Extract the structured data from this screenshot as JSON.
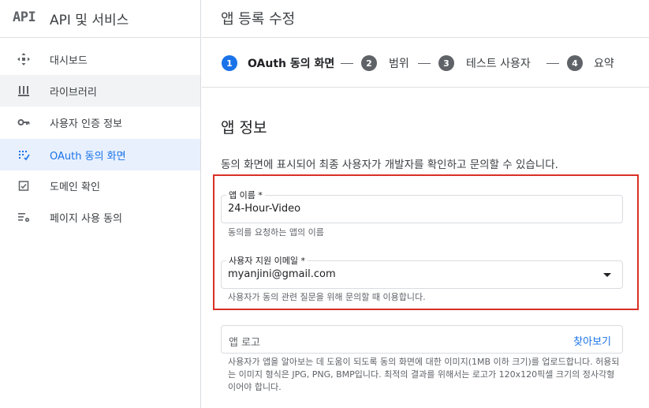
{
  "brand": {
    "logo": "API",
    "title": "API 및 서비스"
  },
  "sidebar": {
    "items": [
      {
        "label": "대시보드",
        "icon": "dashboard-icon"
      },
      {
        "label": "라이브러리",
        "icon": "library-icon"
      },
      {
        "label": "사용자 인증 정보",
        "icon": "key-icon"
      },
      {
        "label": "OAuth 동의 화면",
        "icon": "oauth-consent-icon"
      },
      {
        "label": "도메인 확인",
        "icon": "domain-verification-icon"
      },
      {
        "label": "페이지 사용 동의",
        "icon": "page-usage-icon"
      }
    ]
  },
  "header": {
    "title": "앱 등록 수정"
  },
  "stepper": {
    "steps": [
      {
        "number": "1",
        "label": "OAuth 동의 화면",
        "active": true
      },
      {
        "number": "2",
        "label": "범위",
        "active": false
      },
      {
        "number": "3",
        "label": "테스트 사용자",
        "active": false
      },
      {
        "number": "4",
        "label": "요약",
        "active": false
      }
    ]
  },
  "app_info": {
    "title": "앱 정보",
    "description": "동의 화면에 표시되어 최종 사용자가 개발자를 확인하고 문의할 수 있습니다.",
    "app_name": {
      "label": "앱 이름 *",
      "value": "24-Hour-Video",
      "hint": "동의를 요청하는 앱의 이름"
    },
    "support_email": {
      "label": "사용자 지원 이메일 *",
      "value": "myanjini@gmail.com",
      "hint": "사용자가 동의 관련 질문을 위해 문의할 때 이용합니다."
    },
    "app_logo": {
      "label": "앱 로고",
      "browse": "찾아보기",
      "hint": "사용자가 앱을 알아보는 데 도움이 되도록 동의 화면에 대한 이미지(1MB 이하 크기)를 업로드합니다. 허용되는 이미지 형식은 JPG, PNG, BMP입니다. 최적의 결과를 위해서는 로고가 120x120픽셀 크기의 정사각형이어야 합니다."
    }
  },
  "colors": {
    "accent": "#1a73e8",
    "highlight": "#d93025",
    "active_bg": "#e8f0fe"
  }
}
